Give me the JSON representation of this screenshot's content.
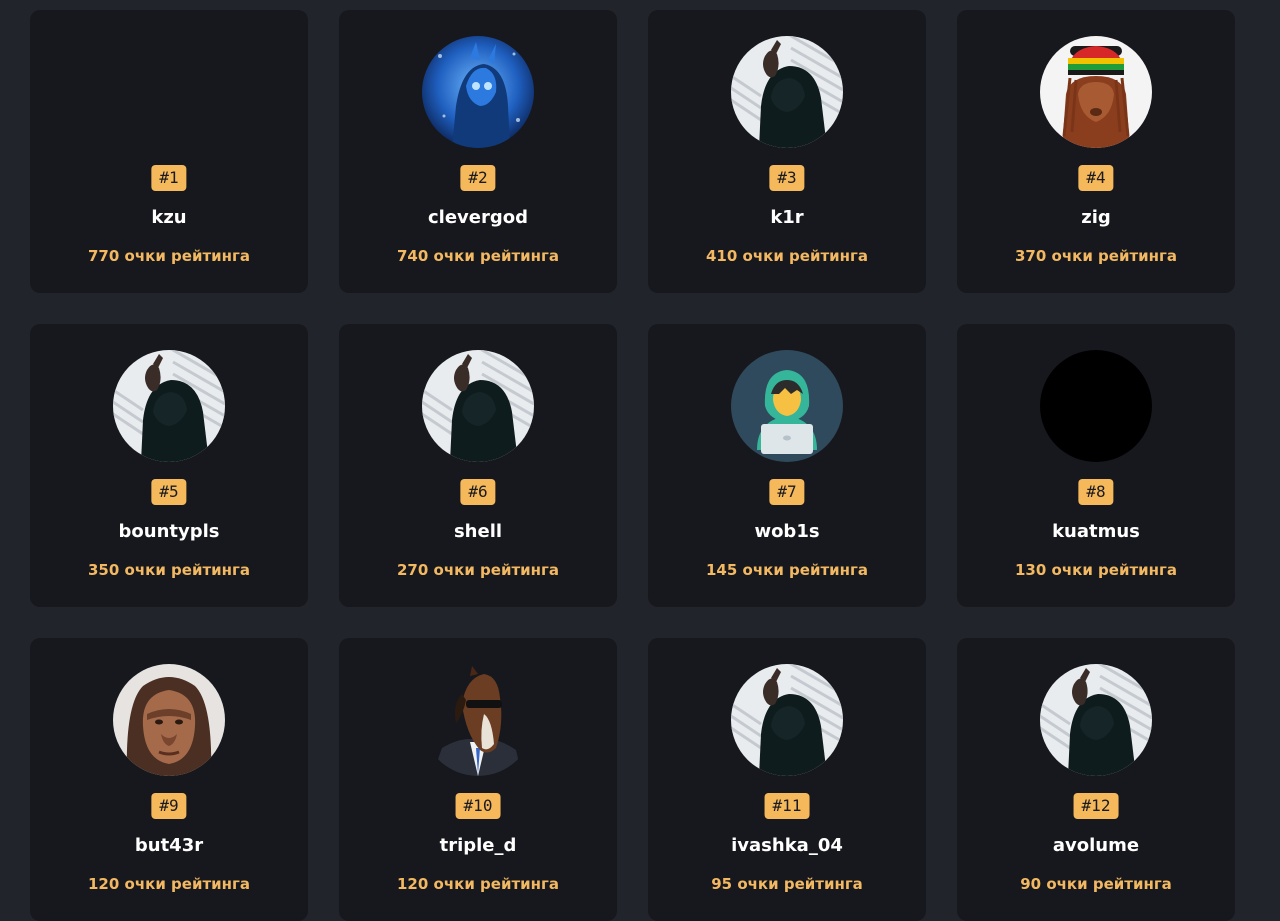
{
  "leaderboard": {
    "cards": [
      {
        "rank": "#1",
        "name": "kzu",
        "points": "770 очки рейтинга",
        "avatar": "none"
      },
      {
        "rank": "#2",
        "name": "clevergod",
        "points": "740 очки рейтинга",
        "avatar": "blue-fantasy-armor-avatar"
      },
      {
        "rank": "#3",
        "name": "k1r",
        "points": "410 очки рейтинга",
        "avatar": "hooded-figure-avatar"
      },
      {
        "rank": "#4",
        "name": "zig",
        "points": "370 очки рейтинга",
        "avatar": "rasta-hat-avatar"
      },
      {
        "rank": "#5",
        "name": "bountypls",
        "points": "350 очки рейтинга",
        "avatar": "hooded-figure-avatar"
      },
      {
        "rank": "#6",
        "name": "shell",
        "points": "270 очки рейтинга",
        "avatar": "hooded-figure-avatar"
      },
      {
        "rank": "#7",
        "name": "wob1s",
        "points": "145 очки рейтинга",
        "avatar": "hacker-laptop-avatar"
      },
      {
        "rank": "#8",
        "name": "kuatmus",
        "points": "130 очки рейтинга",
        "avatar": "black-circle-avatar"
      },
      {
        "rank": "#9",
        "name": "but43r",
        "points": "120 очки рейтинга",
        "avatar": "caveman-face-avatar"
      },
      {
        "rank": "#10",
        "name": "triple_d",
        "points": "120 очки рейтинга",
        "avatar": "horse-in-suit-avatar"
      },
      {
        "rank": "#11",
        "name": "ivashka_04",
        "points": "95 очки рейтинга",
        "avatar": "hooded-figure-avatar"
      },
      {
        "rank": "#12",
        "name": "avolume",
        "points": "90 очки рейтинга",
        "avatar": "hooded-figure-avatar"
      }
    ]
  },
  "colors": {
    "page_background": "#22242c",
    "card_background": "#17181d",
    "rank_badge": "#f5b95c",
    "points_text": "#f2b862",
    "name_text": "#ffffff"
  }
}
